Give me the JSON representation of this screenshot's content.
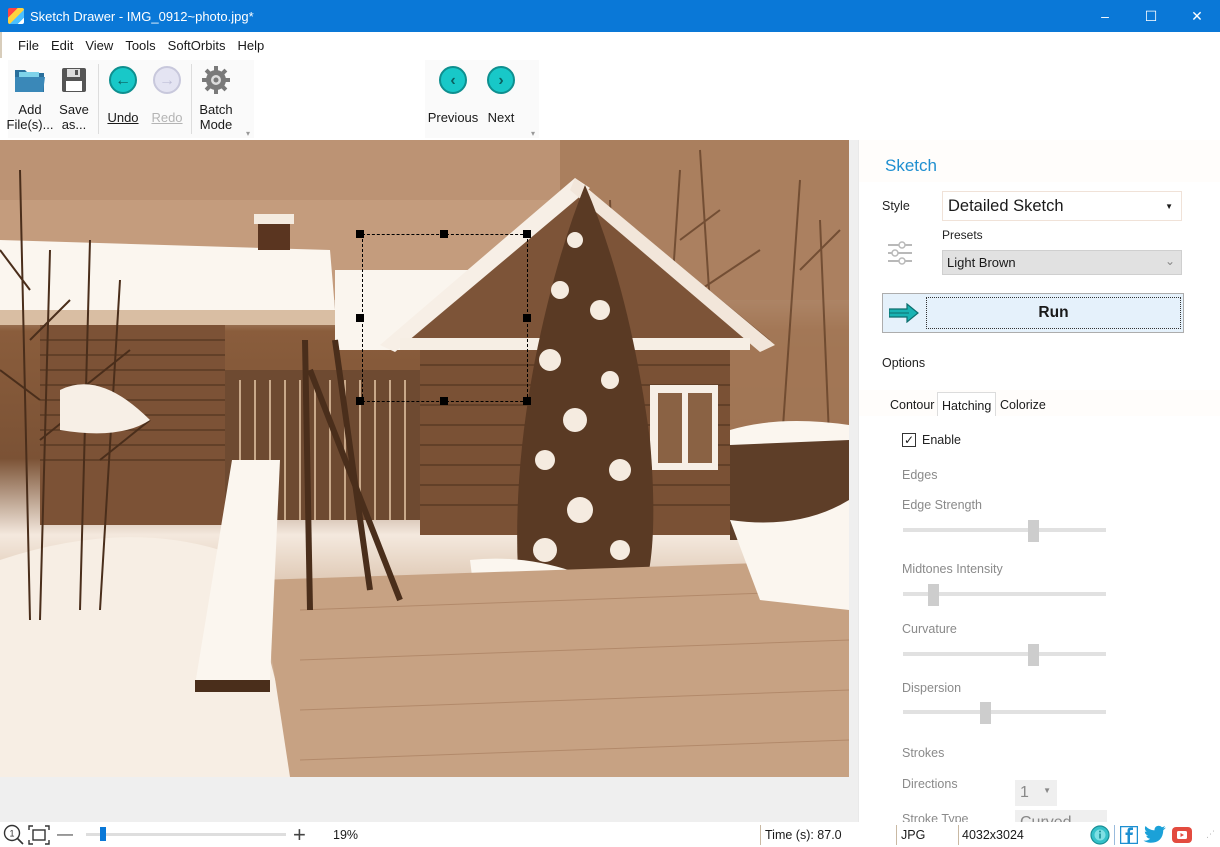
{
  "window": {
    "title": "Sketch Drawer - IMG_0912~photo.jpg*",
    "controls": {
      "minimize": "–",
      "maximize": "☐",
      "close": "✕"
    }
  },
  "menu": [
    {
      "label": "File",
      "accel": "F"
    },
    {
      "label": "Edit",
      "accel": "E"
    },
    {
      "label": "View",
      "accel": "V"
    },
    {
      "label": "Tools",
      "accel": "T"
    },
    {
      "label": "SoftOrbits",
      "accel": ""
    },
    {
      "label": "Help",
      "accel": "H"
    }
  ],
  "toolbar": {
    "add_files": {
      "line1": "Add",
      "line2": "File(s)...",
      "icon": "folder-open-icon"
    },
    "save_as": {
      "line1": "Save",
      "line2": "as...",
      "icon": "floppy-disk-icon"
    },
    "undo": {
      "label": "Undo",
      "icon": "arrow-left-circle-icon"
    },
    "redo": {
      "label": "Redo",
      "icon": "arrow-right-circle-icon",
      "enabled": false
    },
    "batch_mode": {
      "line1": "Batch",
      "line2": "Mode",
      "icon": "gear-icon"
    },
    "previous": {
      "label": "Previous",
      "icon": "chevron-left-circle-icon"
    },
    "next": {
      "label": "Next",
      "icon": "chevron-right-circle-icon"
    }
  },
  "canvas": {
    "image_description": "Sepia sketch of snowy wooden houses with a slide and snow-covered evergreen tree",
    "selection_visible": true
  },
  "panel": {
    "title": "Sketch",
    "style_label": "Style",
    "style_value": "Detailed Sketch",
    "presets_label": "Presets",
    "presets_value": "Light Brown",
    "run_label": "Run",
    "options_label": "Options",
    "tabs": [
      {
        "label": "Contour",
        "active": false
      },
      {
        "label": "Hatching",
        "active": true
      },
      {
        "label": "Colorize",
        "active": false
      }
    ],
    "enable_label": "Enable",
    "enable_checked": true,
    "edges_label": "Edges",
    "sliders": [
      {
        "label": "Edge Strength",
        "value_fraction": 0.65
      },
      {
        "label": "Midtones Intensity",
        "value_fraction": 0.13
      },
      {
        "label": "Curvature",
        "value_fraction": 0.65
      },
      {
        "label": "Dispersion",
        "value_fraction": 0.4
      }
    ],
    "strokes_label": "Strokes",
    "directions_label": "Directions",
    "directions_value": "1",
    "stroke_type_label": "Stroke Type",
    "stroke_type_value": "Curved"
  },
  "statusbar": {
    "zoom_percent": "19%",
    "zoom_fraction": 0.07,
    "time": "Time (s): 87.0",
    "format": "JPG",
    "dimensions": "4032x3024",
    "zoom_minus": "—",
    "zoom_plus": "+"
  }
}
